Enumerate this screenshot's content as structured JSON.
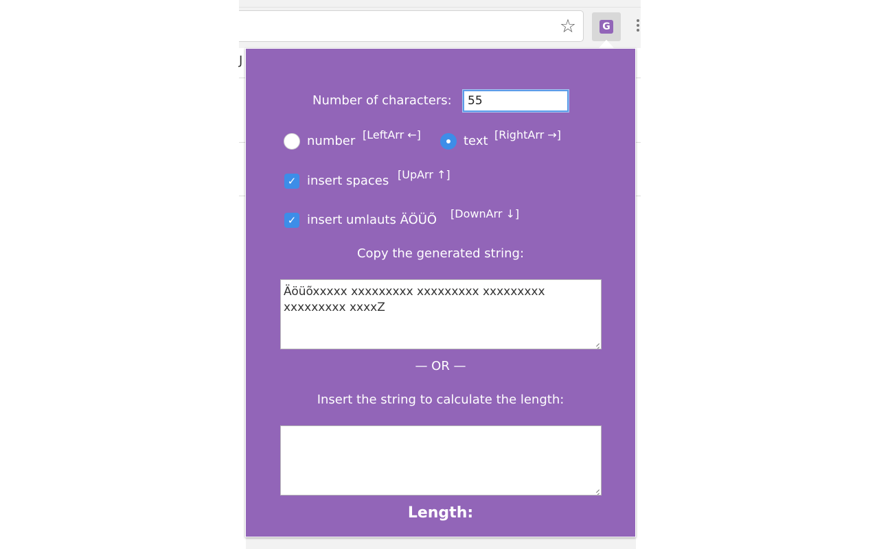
{
  "browser": {
    "omnibox_value": "",
    "page_fragment": "J",
    "bookmark_icon": "star-icon",
    "extension_icon_letter": "G",
    "menu_icon": "kebab-icon"
  },
  "popup": {
    "count_label": "Number of characters:",
    "count_value": "55",
    "options": {
      "number_label": "number",
      "number_hint": "[LeftArr ←]",
      "text_label": "text",
      "text_hint": "[RightArr →]",
      "selected_type": "text",
      "spaces_label": "insert spaces",
      "spaces_hint": "[UpArr ↑]",
      "spaces_checked": true,
      "umlauts_label": "insert umlauts ÄÖÜÕ",
      "umlauts_hint": "[DownArr ↓]",
      "umlauts_checked": true
    },
    "copy_label": "Copy the generated string:",
    "generated_string": "Äöüõxxxxx xxxxxxxxx xxxxxxxxx xxxxxxxxx xxxxxxxxx xxxxZ",
    "or_label": "— OR —",
    "insert_label": "Insert the string to calculate the length:",
    "insert_value": "",
    "length_label": "Length:"
  },
  "colors": {
    "popup_background": "#9265b8",
    "accent_blue": "#3d8de8"
  }
}
